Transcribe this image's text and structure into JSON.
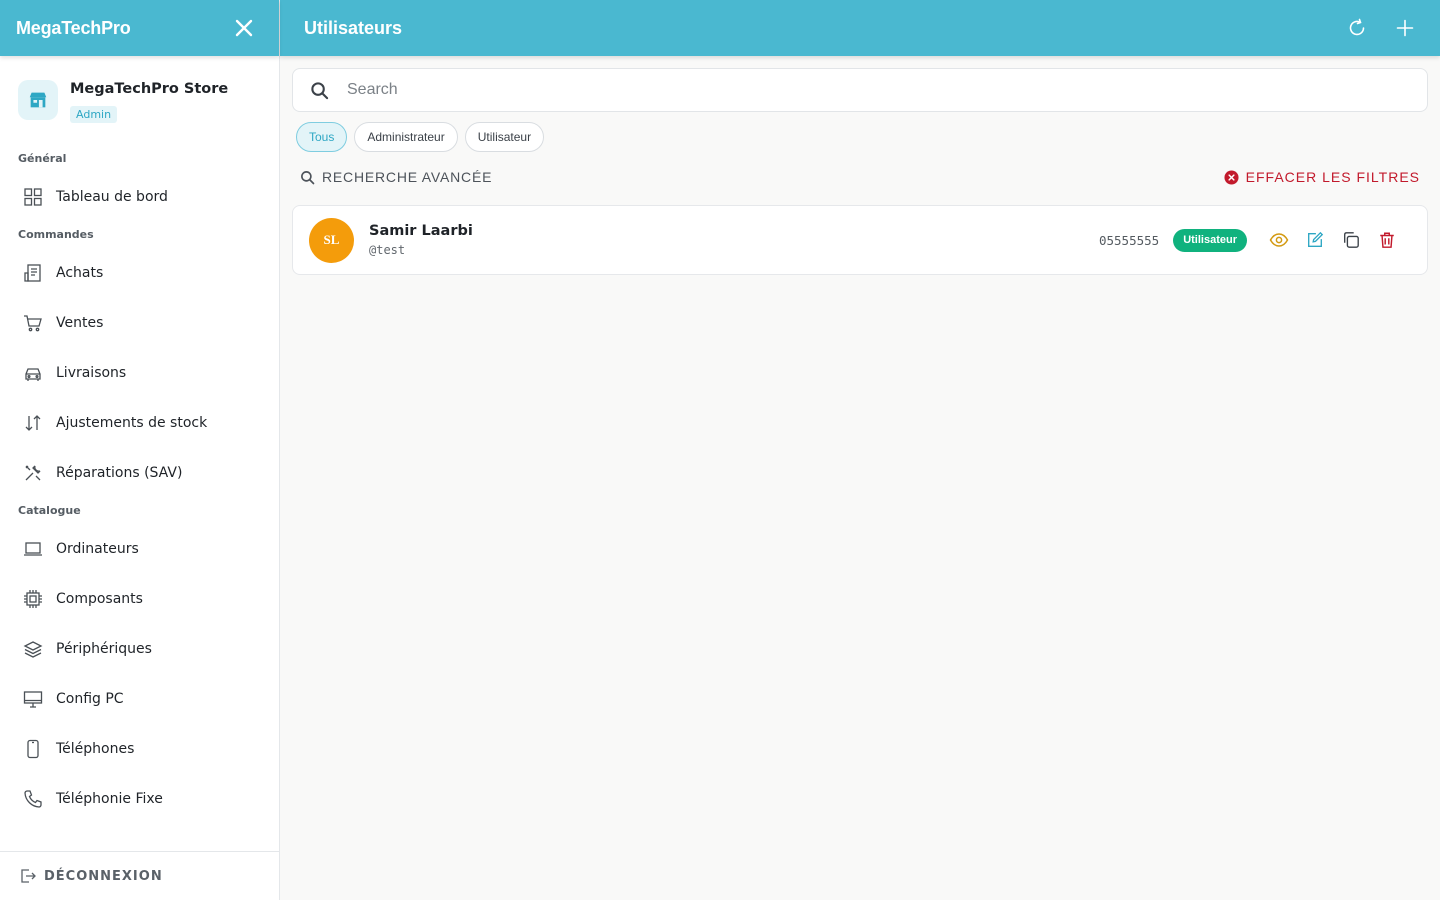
{
  "sidebar": {
    "brand": "MegaTechPro",
    "store": {
      "name": "MegaTechPro Store",
      "role": "Admin"
    },
    "sections": [
      {
        "title": "Général",
        "items": [
          {
            "label": "Tableau de bord",
            "icon": "grid-icon"
          }
        ]
      },
      {
        "title": "Commandes",
        "items": [
          {
            "label": "Achats",
            "icon": "receipt-icon"
          },
          {
            "label": "Ventes",
            "icon": "cart-icon"
          },
          {
            "label": "Livraisons",
            "icon": "car-icon"
          },
          {
            "label": "Ajustements de stock",
            "icon": "arrows-icon"
          },
          {
            "label": "Réparations (SAV)",
            "icon": "tools-icon"
          }
        ]
      },
      {
        "title": "Catalogue",
        "items": [
          {
            "label": "Ordinateurs",
            "icon": "laptop-icon"
          },
          {
            "label": "Composants",
            "icon": "cpu-icon"
          },
          {
            "label": "Périphériques",
            "icon": "layers-icon"
          },
          {
            "label": "Config PC",
            "icon": "monitor-icon"
          },
          {
            "label": "Téléphones",
            "icon": "smartphone-icon"
          },
          {
            "label": "Téléphonie Fixe",
            "icon": "phone-icon"
          }
        ]
      }
    ],
    "logout_label": "DÉCONNEXION"
  },
  "header": {
    "title": "Utilisateurs"
  },
  "search": {
    "placeholder": "Search",
    "value": ""
  },
  "filters": {
    "chips": [
      {
        "label": "Tous",
        "active": true
      },
      {
        "label": "Administrateur",
        "active": false
      },
      {
        "label": "Utilisateur",
        "active": false
      }
    ],
    "advanced_label": "RECHERCHE AVANCÉE",
    "clear_label": "EFFACER LES FILTRES"
  },
  "users": [
    {
      "initials": "SL",
      "name": "Samir Laarbi",
      "handle": "@test",
      "phone": "05555555",
      "role": "Utilisateur"
    }
  ],
  "colors": {
    "primary": "#4ab8d0",
    "avatar": "#f49c0b",
    "badge": "#10b27e",
    "danger": "#c21a2c",
    "view": "#d39a12",
    "edit": "#2ea7c4"
  }
}
